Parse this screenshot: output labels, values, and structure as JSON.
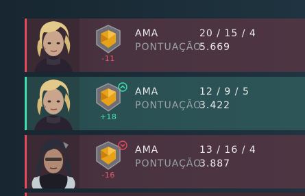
{
  "matches": [
    {
      "result": "loss",
      "agent": "AMA",
      "kda": "20 / 15 / 4",
      "score_label": "PONTUAÇÃO",
      "score": "5.669",
      "rr_change": "-11",
      "arrow": "none",
      "portrait": "blonde-agent-portrait"
    },
    {
      "result": "win",
      "agent": "AMA",
      "kda": "12 / 9 / 5",
      "score_label": "PONTUAÇÃO",
      "score": "3.422",
      "rr_change": "+18",
      "arrow": "rank-up",
      "portrait": "blonde-agent-portrait"
    },
    {
      "result": "loss",
      "agent": "AMA",
      "kda": "13 / 16 / 4",
      "score_label": "PONTUAÇÃO",
      "score": "3.887",
      "rr_change": "-16",
      "arrow": "rank-down",
      "portrait": "dark-haired-agent-portrait"
    }
  ],
  "colors": {
    "loss_accent": "#e7485a",
    "win_accent": "#3fe0b0",
    "rank_gold": "#e8a21a"
  }
}
